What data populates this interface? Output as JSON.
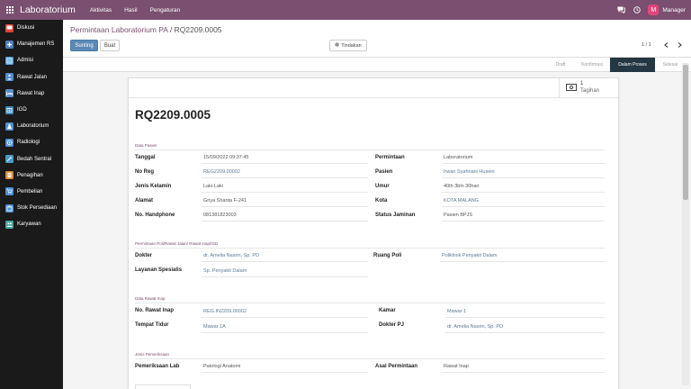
{
  "topbar": {
    "app_name": "Laboratorium",
    "menu": [
      "Aktivitas",
      "Hasil",
      "Pengaturan"
    ],
    "avatar_letter": "M",
    "user": "Manager"
  },
  "sidebar": {
    "items": [
      {
        "label": "Diskusi",
        "icon": "chat-icon",
        "color": "#e2463f"
      },
      {
        "label": "Manajemen RS",
        "icon": "hospital-icon",
        "color": "#4f7fc1"
      },
      {
        "label": "Admisi",
        "icon": "admission-icon",
        "color": "#4f9fd8"
      },
      {
        "label": "Rawat Jalan",
        "icon": "outpatient-icon",
        "color": "#4f8fd0"
      },
      {
        "label": "Rawat Inap",
        "icon": "bed-icon",
        "color": "#5a8fc7"
      },
      {
        "label": "IGD",
        "icon": "emergency-icon",
        "color": "#3f88c5"
      },
      {
        "label": "Laboratorium",
        "icon": "lab-flask-icon",
        "color": "#4c8fd4"
      },
      {
        "label": "Radiologi",
        "icon": "radiology-icon",
        "color": "#4c8fd4"
      },
      {
        "label": "Bedah Sentral",
        "icon": "surgery-icon",
        "color": "#4a9ac9"
      },
      {
        "label": "Penagihan",
        "icon": "billing-icon",
        "color": "#d98a3a"
      },
      {
        "label": "Pembelian",
        "icon": "purchase-icon",
        "color": "#4c8fd4"
      },
      {
        "label": "Stok Persediaan",
        "icon": "inventory-icon",
        "color": "#4c8fd4"
      },
      {
        "label": "Karyawan",
        "icon": "employees-icon",
        "color": "#4aa3a3"
      }
    ]
  },
  "control_panel": {
    "breadcrumb_parent": "Permintaan Laboratorium PA",
    "breadcrumb_sep": " / ",
    "breadcrumb_current": "RQ2209.0005",
    "edit_label": "Sunting",
    "create_label": "Buat",
    "action_label": "Tindakan",
    "pager": "1 / 1"
  },
  "statusbar": {
    "stages": [
      {
        "label": "Draft",
        "active": false
      },
      {
        "label": "Konfirmasi",
        "active": false
      },
      {
        "label": "Dalam Proses",
        "active": true
      },
      {
        "label": "Selesai",
        "active": false
      }
    ]
  },
  "form": {
    "stat_count": "1",
    "stat_label": "Tagihan",
    "title": "RQ2209.0005",
    "sections": {
      "patient": "Data Pasien",
      "poli": "Permintaan Poli/Rawat Jalan/ Rawat Inap/IGD",
      "inpatient": "Data Rawat Inap",
      "exam": "Jenis Pemeriksaan"
    },
    "patient": {
      "tanggal_label": "Tanggal",
      "tanggal": "15/09/2022 09:37:45",
      "noreg_label": "No Reg",
      "noreg": "REG2209.00002",
      "jk_label": "Jenis Kelamin",
      "jk": "Laki-Laki",
      "alamat_label": "Alamat",
      "alamat": "Griya Shanta F-241",
      "hp_label": "No. Handphone",
      "hp": "081381823003",
      "permintaan_label": "Permintaan",
      "permintaan": "Laboratorium",
      "pasien_label": "Pasien",
      "pasien": "Irwan Syahriani Husein",
      "umur_label": "Umur",
      "umur": "40th 3bln 30hari",
      "kota_label": "Kota",
      "kota": "KOTA MALANG",
      "jaminan_label": "Status Jaminan",
      "jaminan": "Pasien BPJS"
    },
    "poli": {
      "dokter_label": "Dokter",
      "dokter": "dr. Amelia Nasrin, Sp. PD",
      "layanan_label": "Layanan Spesialis",
      "layanan": "Sp. Penyakit Dalam",
      "ruang_label": "Ruang Poli",
      "ruang": "Poliklinik Penyakit Dalam"
    },
    "inpatient": {
      "norawat_label": "No. Rawat Inap",
      "norawat": "REG.IN2209.00002",
      "tempat_label": "Tempat Tidur",
      "tempat": "Mawar 1A",
      "kamar_label": "Kamar",
      "kamar": "Mawar 1",
      "dokterpj_label": "Dokter PJ",
      "dokterpj": "dr. Amelia Nasrin, Sp. PD"
    },
    "exam": {
      "lab_label": "Pemeriksaan Lab",
      "lab": "Patologi Anatomi",
      "asal_label": "Asal Permintaan",
      "asal": "Rawat Inap"
    }
  }
}
